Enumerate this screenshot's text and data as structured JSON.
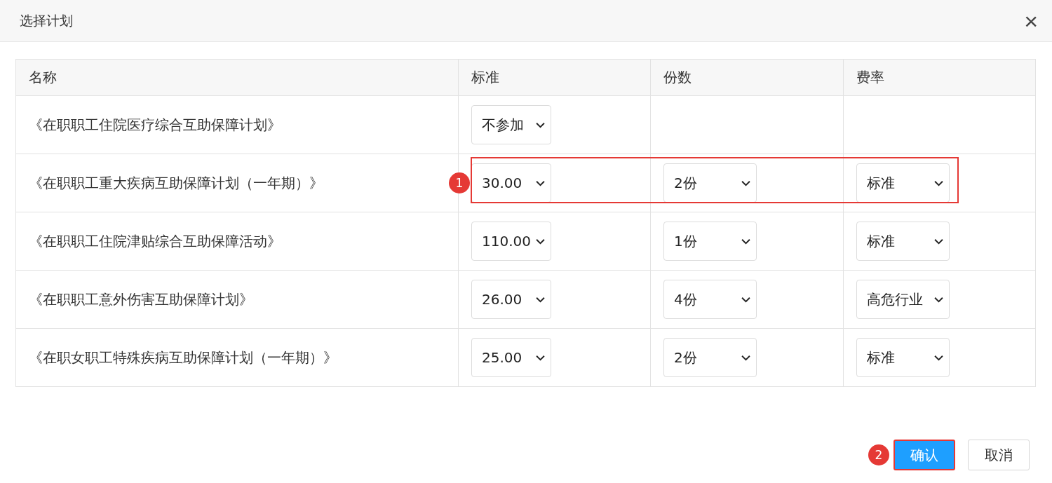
{
  "dialog": {
    "title": "选择计划",
    "close": "×"
  },
  "table": {
    "columns": [
      "名称",
      "标准",
      "份数",
      "费率"
    ],
    "rows": [
      {
        "name": "《在职职工住院医疗综合互助保障计划》",
        "standard": "不参加",
        "highlighted": false
      },
      {
        "name": "《在职职工重大疾病互助保障计划（一年期）》",
        "standard": "30.00",
        "shares": "2份",
        "rate": "标准",
        "highlighted": true,
        "badge": "1"
      },
      {
        "name": "《在职职工住院津贴综合互助保障活动》",
        "standard": "110.00",
        "shares": "1份",
        "rate": "标准",
        "highlighted": false
      },
      {
        "name": "《在职职工意外伤害互助保障计划》",
        "standard": "26.00",
        "shares": "4份",
        "rate": "高危行业",
        "highlighted": false
      },
      {
        "name": "《在职女职工特殊疾病互助保障计划（一年期）》",
        "standard": "25.00",
        "shares": "2份",
        "rate": "标准",
        "highlighted": false
      }
    ]
  },
  "buttons": [
    {
      "label": "确认",
      "kind": "primary",
      "highlighted": true,
      "badge": "2"
    },
    {
      "label": "取消",
      "kind": "default",
      "highlighted": false
    }
  ]
}
